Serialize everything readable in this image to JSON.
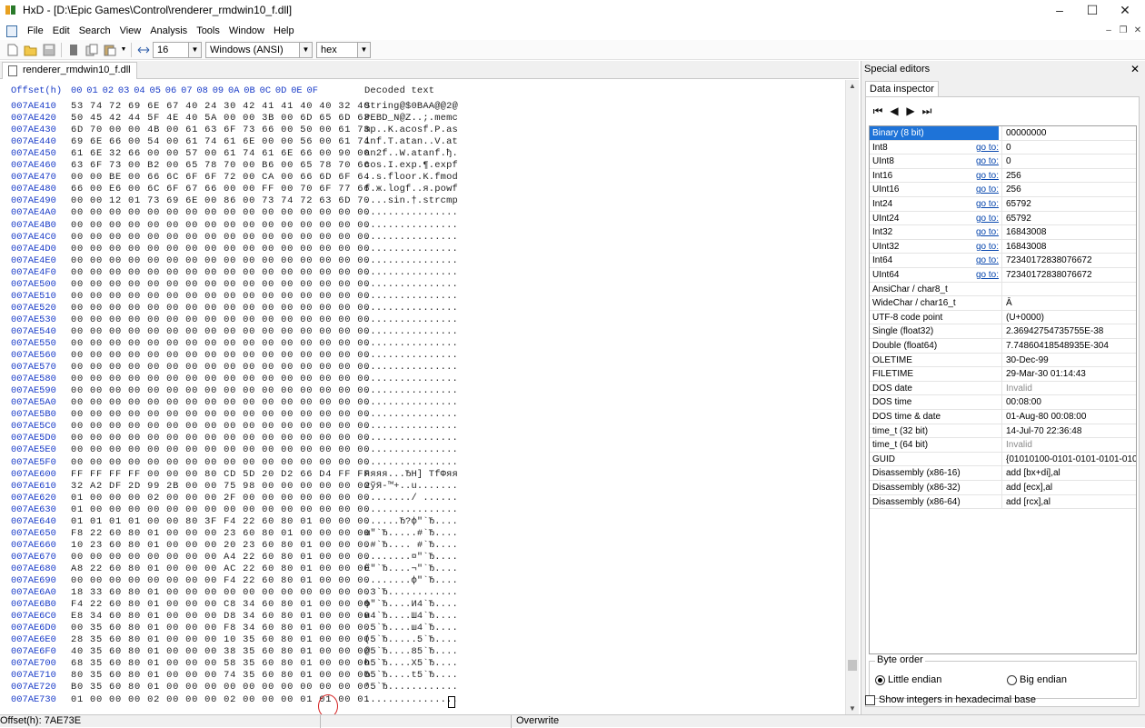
{
  "window": {
    "title": "HxD - [D:\\Epic Games\\Control\\renderer_rmdwin10_f.dll]",
    "minimize": "–",
    "maximize": "☐",
    "close": "✕"
  },
  "menu": [
    "File",
    "Edit",
    "Search",
    "View",
    "Analysis",
    "Tools",
    "Window",
    "Help"
  ],
  "toolbar": {
    "bytes_per_row": "16",
    "charset": "Windows (ANSI)",
    "offset_base": "hex"
  },
  "tabs": {
    "document": "renderer_rmdwin10_f.dll"
  },
  "hex": {
    "header_offset": "Offset(h)",
    "header_cols": [
      "00",
      "01",
      "02",
      "03",
      "04",
      "05",
      "06",
      "07",
      "08",
      "09",
      "0A",
      "0B",
      "0C",
      "0D",
      "0E",
      "0F"
    ],
    "header_text": "Decoded text",
    "rows": [
      {
        "off": "007AE410",
        "b": "53 74 72 69 6E 67 40 24 30 42 41 41 40 40 32 40",
        "t": "String@$0BAA@@2@"
      },
      {
        "off": "007AE420",
        "b": "50 45 42 44 5F 4E 40 5A 00 00 3B 00 6D 65 6D 63",
        "t": "PEBD_N@Z..;.memc"
      },
      {
        "off": "007AE430",
        "b": "6D 70 00 00 4B 00 61 63 6F 73 66 00 50 00 61 73",
        "t": "mp..K.acosf.P.as"
      },
      {
        "off": "007AE440",
        "b": "69 6E 66 00 54 00 61 74 61 6E 00 00 56 00 61 74",
        "t": "inf.T.atan..V.at"
      },
      {
        "off": "007AE450",
        "b": "61 6E 32 66 00 00 57 00 61 74 61 6E 66 00 90 00",
        "t": "an2f..W.atanf.ђ."
      },
      {
        "off": "007AE460",
        "b": "63 6F 73 00 B2 00 65 78 70 00 B6 00 65 78 70 66",
        "t": "cos.I.exp.¶.expf"
      },
      {
        "off": "007AE470",
        "b": "00 00 BE 00 66 6C 6F 6F 72 00 CA 00 66 6D 6F 64",
        "t": "..s.floor.K.fmod"
      },
      {
        "off": "007AE480",
        "b": "66 00 E6 00 6C 6F 67 66 00 00 FF 00 70 6F 77 66",
        "t": "f.ж.logf..я.powf"
      },
      {
        "off": "007AE490",
        "b": "00 00 12 01 73 69 6E 00 86 00 73 74 72 63 6D 70",
        "t": "....sin.†.strcmp"
      },
      {
        "off": "007AE4A0",
        "b": "00 00 00 00 00 00 00 00 00 00 00 00 00 00 00 00",
        "t": "................"
      },
      {
        "off": "007AE4B0",
        "b": "00 00 00 00 00 00 00 00 00 00 00 00 00 00 00 00",
        "t": "................"
      },
      {
        "off": "007AE4C0",
        "b": "00 00 00 00 00 00 00 00 00 00 00 00 00 00 00 00",
        "t": "................"
      },
      {
        "off": "007AE4D0",
        "b": "00 00 00 00 00 00 00 00 00 00 00 00 00 00 00 00",
        "t": "................"
      },
      {
        "off": "007AE4E0",
        "b": "00 00 00 00 00 00 00 00 00 00 00 00 00 00 00 00",
        "t": "................"
      },
      {
        "off": "007AE4F0",
        "b": "00 00 00 00 00 00 00 00 00 00 00 00 00 00 00 00",
        "t": "................"
      },
      {
        "off": "007AE500",
        "b": "00 00 00 00 00 00 00 00 00 00 00 00 00 00 00 00",
        "t": "................"
      },
      {
        "off": "007AE510",
        "b": "00 00 00 00 00 00 00 00 00 00 00 00 00 00 00 00",
        "t": "................"
      },
      {
        "off": "007AE520",
        "b": "00 00 00 00 00 00 00 00 00 00 00 00 00 00 00 00",
        "t": "................"
      },
      {
        "off": "007AE530",
        "b": "00 00 00 00 00 00 00 00 00 00 00 00 00 00 00 00",
        "t": "................"
      },
      {
        "off": "007AE540",
        "b": "00 00 00 00 00 00 00 00 00 00 00 00 00 00 00 00",
        "t": "................"
      },
      {
        "off": "007AE550",
        "b": "00 00 00 00 00 00 00 00 00 00 00 00 00 00 00 00",
        "t": "................"
      },
      {
        "off": "007AE560",
        "b": "00 00 00 00 00 00 00 00 00 00 00 00 00 00 00 00",
        "t": "................"
      },
      {
        "off": "007AE570",
        "b": "00 00 00 00 00 00 00 00 00 00 00 00 00 00 00 00",
        "t": "................"
      },
      {
        "off": "007AE580",
        "b": "00 00 00 00 00 00 00 00 00 00 00 00 00 00 00 00",
        "t": "................"
      },
      {
        "off": "007AE590",
        "b": "00 00 00 00 00 00 00 00 00 00 00 00 00 00 00 00",
        "t": "................"
      },
      {
        "off": "007AE5A0",
        "b": "00 00 00 00 00 00 00 00 00 00 00 00 00 00 00 00",
        "t": "................"
      },
      {
        "off": "007AE5B0",
        "b": "00 00 00 00 00 00 00 00 00 00 00 00 00 00 00 00",
        "t": "................"
      },
      {
        "off": "007AE5C0",
        "b": "00 00 00 00 00 00 00 00 00 00 00 00 00 00 00 00",
        "t": "................"
      },
      {
        "off": "007AE5D0",
        "b": "00 00 00 00 00 00 00 00 00 00 00 00 00 00 00 00",
        "t": "................"
      },
      {
        "off": "007AE5E0",
        "b": "00 00 00 00 00 00 00 00 00 00 00 00 00 00 00 00",
        "t": "................"
      },
      {
        "off": "007AE5F0",
        "b": "00 00 00 00 00 00 00 00 00 00 00 00 00 00 00 00",
        "t": "................"
      },
      {
        "off": "007AE600",
        "b": "FF FF FF FF 00 00 00 80 CD 5D 20 D2 66 D4 FF FF",
        "t": "яяяя...ЂН] ТfФяя"
      },
      {
        "off": "007AE610",
        "b": "32 A2 DF 2D 99 2B 00 00 75 98 00 00 00 00 00 00",
        "t": "2ўЯ-™+..u......."
      },
      {
        "off": "007AE620",
        "b": "01 00 00 00 02 00 00 00 2F 00 00 00 00 00 00 00",
        "t": "......../ ......"
      },
      {
        "off": "007AE630",
        "b": "01 00 00 00 00 00 00 00 00 00 00 00 00 00 00 00",
        "t": "................"
      },
      {
        "off": "007AE640",
        "b": "01 01 01 01 00 00 80 3F F4 22 60 80 01 00 00 00",
        "t": "......Ђ?ф\"`Ђ...."
      },
      {
        "off": "007AE650",
        "b": "F8 22 60 80 01 00 00 00 23 60 80 01 00 00 00 00",
        "t": "ш\"`Ђ.....#`Ђ...."
      },
      {
        "off": "007AE660",
        "b": "10 23 60 80 01 00 00 00 20 23 60 80 01 00 00 00",
        "t": ".#`Ђ.... #`Ђ...."
      },
      {
        "off": "007AE670",
        "b": "00 00 00 00 00 00 00 00 A4 22 60 80 01 00 00 00",
        "t": "........¤\"`Ђ...."
      },
      {
        "off": "007AE680",
        "b": "A8 22 60 80 01 00 00 00 AC 22 60 80 01 00 00 00",
        "t": "Ё\"`Ђ....¬\"`Ђ...."
      },
      {
        "off": "007AE690",
        "b": "00 00 00 00 00 00 00 00 F4 22 60 80 01 00 00 00",
        "t": "........ф\"`Ђ...."
      },
      {
        "off": "007AE6A0",
        "b": "18 33 60 80 01 00 00 00 00 00 00 00 00 00 00 00",
        "t": ".3`Ђ............"
      },
      {
        "off": "007AE6B0",
        "b": "F4 22 60 80 01 00 00 00 C8 34 60 80 01 00 00 00",
        "t": "ф\"`Ђ....И4`Ђ...."
      },
      {
        "off": "007AE6C0",
        "b": "E8 34 60 80 01 00 00 00 D8 34 60 80 01 00 00 00",
        "t": "и4`Ђ....Ш4`Ђ...."
      },
      {
        "off": "007AE6D0",
        "b": "00 35 60 80 01 00 00 00 F8 34 60 80 01 00 00 00",
        "t": ".5`Ђ....ш4`Ђ...."
      },
      {
        "off": "007AE6E0",
        "b": "28 35 60 80 01 00 00 00 10 35 60 80 01 00 00 00",
        "t": "(5`Ђ.....5`Ђ...."
      },
      {
        "off": "007AE6F0",
        "b": "40 35 60 80 01 00 00 00 38 35 60 80 01 00 00 00",
        "t": "@5`Ђ....85`Ђ...."
      },
      {
        "off": "007AE700",
        "b": "68 35 60 80 01 00 00 00 58 35 60 80 01 00 00 00",
        "t": "h5`Ђ....X5`Ђ...."
      },
      {
        "off": "007AE710",
        "b": "80 35 60 80 01 00 00 00 74 35 60 80 01 00 00 00",
        "t": "Ђ5`Ђ....t5`Ђ...."
      },
      {
        "off": "007AE720",
        "b": "B0 35 60 80 01 00 00 00 00 00 00 00 00 00 00 00",
        "t": "°5`Ђ............"
      },
      {
        "off": "007AE730",
        "b": "01 00 00 00 02 00 00 00 02 00 00 00 01 01 00 01",
        "t": "................"
      }
    ]
  },
  "special_editors": {
    "title": "Special editors",
    "close": "✕",
    "tab": "Data inspector"
  },
  "nav": [
    "⏮",
    "◀",
    "▶",
    "⏭"
  ],
  "inspector": [
    {
      "name": "Binary (8 bit)",
      "goto": "",
      "value": "00000000",
      "sel": true
    },
    {
      "name": "Int8",
      "goto": "go to:",
      "value": "0"
    },
    {
      "name": "UInt8",
      "goto": "go to:",
      "value": "0"
    },
    {
      "name": "Int16",
      "goto": "go to:",
      "value": "256"
    },
    {
      "name": "UInt16",
      "goto": "go to:",
      "value": "256"
    },
    {
      "name": "Int24",
      "goto": "go to:",
      "value": "65792"
    },
    {
      "name": "UInt24",
      "goto": "go to:",
      "value": "65792"
    },
    {
      "name": "Int32",
      "goto": "go to:",
      "value": "16843008"
    },
    {
      "name": "UInt32",
      "goto": "go to:",
      "value": "16843008"
    },
    {
      "name": "Int64",
      "goto": "go to:",
      "value": "72340172838076672"
    },
    {
      "name": "UInt64",
      "goto": "go to:",
      "value": "72340172838076672"
    },
    {
      "name": "AnsiChar / char8_t",
      "goto": "",
      "value": ""
    },
    {
      "name": "WideChar / char16_t",
      "goto": "",
      "value": "Ā"
    },
    {
      "name": "UTF-8 code point",
      "goto": "",
      "value": "   (U+0000)"
    },
    {
      "name": "Single (float32)",
      "goto": "",
      "value": "2.36942754735755E-38"
    },
    {
      "name": "Double (float64)",
      "goto": "",
      "value": "7.74860418548935E-304"
    },
    {
      "name": "OLETIME",
      "goto": "",
      "value": "30-Dec-99"
    },
    {
      "name": "FILETIME",
      "goto": "",
      "value": "29-Mar-30 01:14:43"
    },
    {
      "name": "DOS date",
      "goto": "",
      "value": "Invalid",
      "gray": true
    },
    {
      "name": "DOS time",
      "goto": "",
      "value": "00:08:00"
    },
    {
      "name": "DOS time & date",
      "goto": "",
      "value": "01-Aug-80 00:08:00"
    },
    {
      "name": "time_t (32 bit)",
      "goto": "",
      "value": "14-Jul-70 22:36:48"
    },
    {
      "name": "time_t (64 bit)",
      "goto": "",
      "value": "Invalid",
      "gray": true
    },
    {
      "name": "GUID",
      "goto": "",
      "value": "{01010100-0101-0101-0101-01010"
    },
    {
      "name": "Disassembly (x86-16)",
      "goto": "",
      "value": "add [bx+di],al"
    },
    {
      "name": "Disassembly (x86-32)",
      "goto": "",
      "value": "add [ecx],al"
    },
    {
      "name": "Disassembly (x86-64)",
      "goto": "",
      "value": "add [rcx],al"
    }
  ],
  "byte_order": {
    "legend": "Byte order",
    "little": "Little endian",
    "big": "Big endian"
  },
  "hex_checkbox": "Show integers in hexadecimal base",
  "status": {
    "offset": "Offset(h): 7AE73E",
    "mode": "Overwrite"
  }
}
